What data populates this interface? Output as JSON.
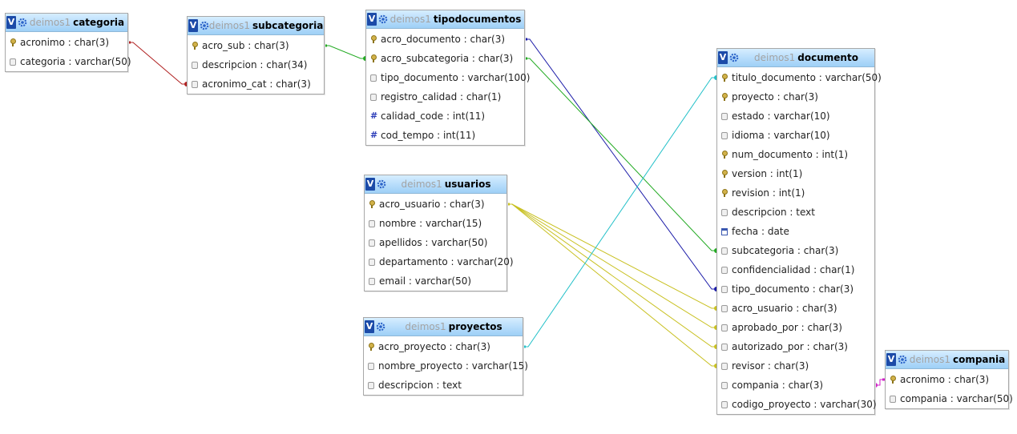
{
  "tables": [
    {
      "id": "categoria",
      "db": "deimos1",
      "name": "categoria",
      "fields": [
        {
          "icon": "key-icon",
          "label": "acronimo : char(3)"
        },
        {
          "icon": "column-icon",
          "label": "categoria : varchar(50)"
        }
      ]
    },
    {
      "id": "subcategoria",
      "db": "deimos1",
      "name": "subcategoria",
      "fields": [
        {
          "icon": "key-icon",
          "label": "acro_sub : char(3)"
        },
        {
          "icon": "column-icon",
          "label": "descripcion : char(34)"
        },
        {
          "icon": "column-icon",
          "label": "acronimo_cat : char(3)"
        }
      ]
    },
    {
      "id": "tipodocumentos",
      "db": "deimos1",
      "name": "tipodocumentos",
      "fields": [
        {
          "icon": "key-icon",
          "label": "acro_documento : char(3)"
        },
        {
          "icon": "key-icon",
          "label": "acro_subcategoria : char(3)"
        },
        {
          "icon": "column-icon",
          "label": "tipo_documento : varchar(100)"
        },
        {
          "icon": "column-icon",
          "label": "registro_calidad : char(1)"
        },
        {
          "icon": "numeric-icon",
          "label": "calidad_code : int(11)"
        },
        {
          "icon": "numeric-icon",
          "label": "cod_tempo : int(11)"
        }
      ]
    },
    {
      "id": "usuarios",
      "db": "deimos1",
      "name": "usuarios",
      "fields": [
        {
          "icon": "key-icon",
          "label": "acro_usuario : char(3)"
        },
        {
          "icon": "column-icon",
          "label": "nombre : varchar(15)"
        },
        {
          "icon": "column-icon",
          "label": "apellidos : varchar(50)"
        },
        {
          "icon": "column-icon",
          "label": "departamento : varchar(20)"
        },
        {
          "icon": "column-icon",
          "label": "email : varchar(50)"
        }
      ]
    },
    {
      "id": "proyectos",
      "db": "deimos1",
      "name": "proyectos",
      "fields": [
        {
          "icon": "key-icon",
          "label": "acro_proyecto : char(3)"
        },
        {
          "icon": "column-icon",
          "label": "nombre_proyecto : varchar(15)"
        },
        {
          "icon": "column-icon",
          "label": "descripcion : text"
        }
      ]
    },
    {
      "id": "documento",
      "db": "deimos1",
      "name": "documento",
      "fields": [
        {
          "icon": "key-icon",
          "label": "titulo_documento : varchar(50)"
        },
        {
          "icon": "key-icon",
          "label": "proyecto : char(3)"
        },
        {
          "icon": "column-icon",
          "label": "estado : varchar(10)"
        },
        {
          "icon": "column-icon",
          "label": "idioma : varchar(10)"
        },
        {
          "icon": "key-icon",
          "label": "num_documento : int(1)"
        },
        {
          "icon": "key-icon",
          "label": "version : int(1)"
        },
        {
          "icon": "key-icon",
          "label": "revision : int(1)"
        },
        {
          "icon": "column-icon",
          "label": "descripcion : text"
        },
        {
          "icon": "date-icon",
          "label": "fecha : date"
        },
        {
          "icon": "column-icon",
          "label": "subcategoria : char(3)"
        },
        {
          "icon": "column-icon",
          "label": "confidencialidad : char(1)"
        },
        {
          "icon": "column-icon",
          "label": "tipo_documento : char(3)"
        },
        {
          "icon": "column-icon",
          "label": "acro_usuario : char(3)"
        },
        {
          "icon": "column-icon",
          "label": "aprobado_por : char(3)"
        },
        {
          "icon": "column-icon",
          "label": "autorizado_por : char(3)"
        },
        {
          "icon": "column-icon",
          "label": "revisor : char(3)"
        },
        {
          "icon": "column-icon",
          "label": "compania : char(3)"
        },
        {
          "icon": "column-icon",
          "label": "codigo_proyecto : varchar(30)"
        }
      ]
    },
    {
      "id": "compania",
      "db": "deimos1",
      "name": "compania",
      "fields": [
        {
          "icon": "key-icon",
          "label": "acronimo : char(3)"
        },
        {
          "icon": "column-icon",
          "label": "compania : varchar(50)"
        }
      ]
    }
  ],
  "relations": [
    {
      "from_table": "categoria",
      "from_field": 0,
      "to_table": "subcategoria",
      "to_field": 2,
      "color": "#b02020"
    },
    {
      "from_table": "subcategoria",
      "from_field": 0,
      "to_table": "tipodocumentos",
      "to_field": 1,
      "color": "#22aa22"
    },
    {
      "from_table": "tipodocumentos",
      "from_field": 0,
      "to_table": "documento",
      "to_field": 11,
      "color": "#1a1aa8"
    },
    {
      "from_table": "tipodocumentos",
      "from_field": 1,
      "to_table": "documento",
      "to_field": 9,
      "color": "#22aa22"
    },
    {
      "from_table": "usuarios",
      "from_field": 0,
      "to_table": "documento",
      "to_field": 12,
      "color": "#c8c020"
    },
    {
      "from_table": "usuarios",
      "from_field": 0,
      "to_table": "documento",
      "to_field": 13,
      "color": "#c8c020"
    },
    {
      "from_table": "usuarios",
      "from_field": 0,
      "to_table": "documento",
      "to_field": 14,
      "color": "#c8c020"
    },
    {
      "from_table": "usuarios",
      "from_field": 0,
      "to_table": "documento",
      "to_field": 15,
      "color": "#c8c020"
    },
    {
      "from_table": "proyectos",
      "from_field": 0,
      "to_table": "documento",
      "to_field": 0,
      "color": "#22c0c8"
    },
    {
      "from_table": "compania",
      "from_field": 0,
      "to_table": "documento",
      "to_field": 16,
      "color": "#d020c8"
    }
  ]
}
